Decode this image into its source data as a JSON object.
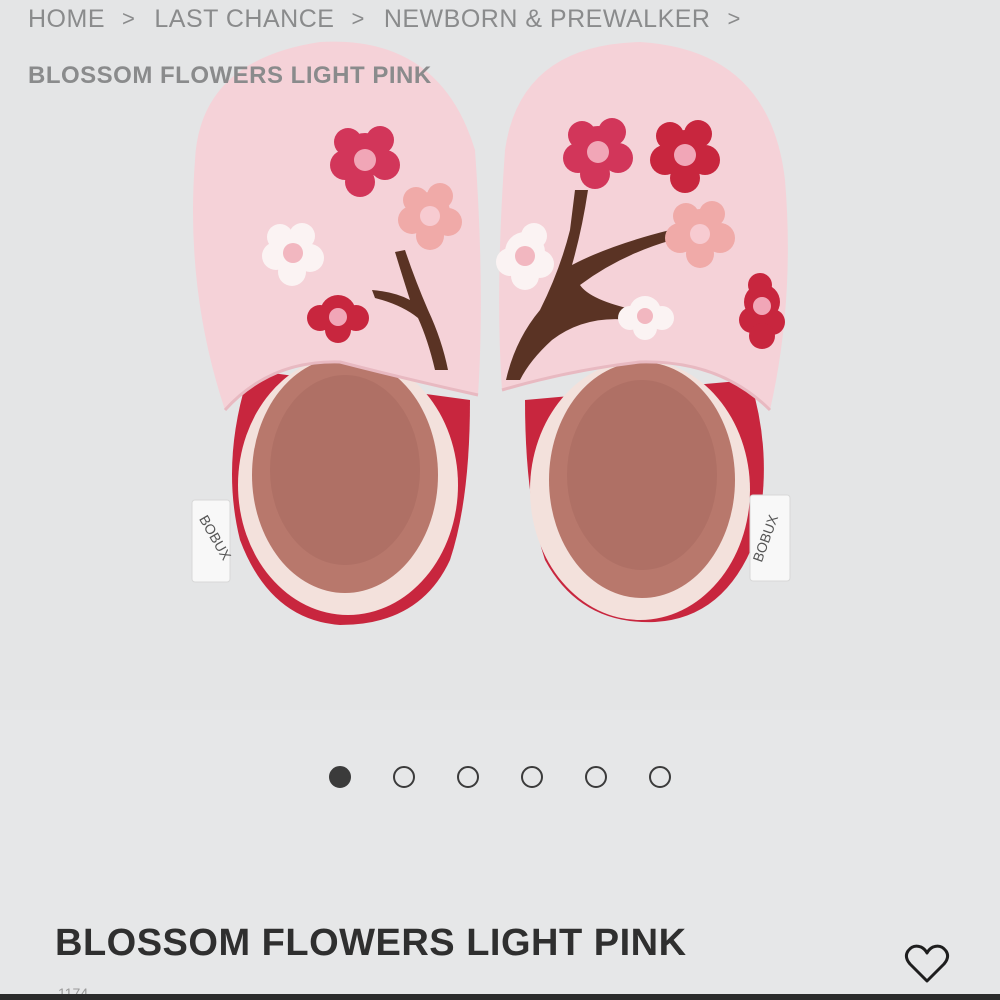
{
  "breadcrumb": {
    "items": [
      "HOME",
      "LAST CHANCE",
      "NEWBORN & PREWALKER"
    ],
    "separator": ">",
    "current": "BLOSSOM FLOWERS LIGHT PINK"
  },
  "gallery": {
    "image_label": "BOBUX",
    "total_slides": 6,
    "active_slide": 1
  },
  "product": {
    "title": "BLOSSOM FLOWERS LIGHT PINK",
    "sku": "1174"
  },
  "icons": {
    "wishlist": "heart-outline-icon"
  },
  "colors": {
    "background": "#e6e7e8",
    "text_dark": "#2f2f2f",
    "text_muted": "#8a8b8c",
    "shoe_pink": "#f5d2d8",
    "shoe_red": "#c8263e",
    "lining": "#b8786c"
  }
}
